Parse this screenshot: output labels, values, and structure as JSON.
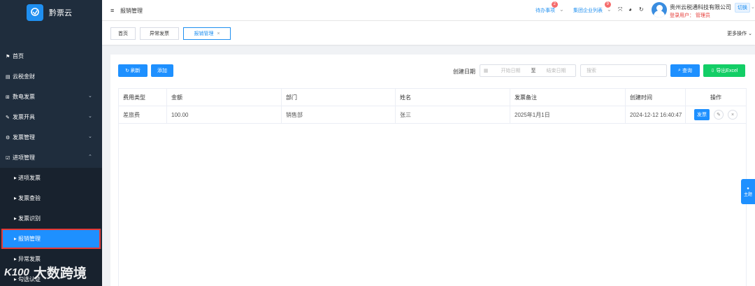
{
  "app": {
    "title": "黔票云",
    "logo_subtext": "黔票云"
  },
  "sidebar": {
    "items": [
      {
        "label": "首页",
        "icon": "home-icon",
        "glyph": "⚑"
      },
      {
        "label": "云税金财",
        "icon": "document-icon",
        "glyph": "▤"
      },
      {
        "label": "数电发票",
        "icon": "plus-square-icon",
        "glyph": "⊞"
      },
      {
        "label": "发票开具",
        "icon": "pen-icon",
        "glyph": "✎"
      },
      {
        "label": "发票管理",
        "icon": "gear-icon",
        "glyph": "⚙"
      },
      {
        "label": "进项管理",
        "icon": "edit-square-icon",
        "glyph": "☑"
      }
    ],
    "subitems": [
      {
        "label": "进项发票"
      },
      {
        "label": "发票查验"
      },
      {
        "label": "发票识别"
      },
      {
        "label": "报销管理"
      },
      {
        "label": "异常发票"
      },
      {
        "label": "勾选认证"
      }
    ]
  },
  "topbar": {
    "breadcrumb": "报销管理",
    "todo_label": "待办事项",
    "todo_count": "2",
    "group_list_label": "集团企业列表",
    "group_count": "9",
    "company_name": "贵州云税通科技有限公司",
    "switch_label": "切换",
    "login_user": "登录用户： 管理员"
  },
  "tabs": [
    {
      "label": "首页"
    },
    {
      "label": "异常发票"
    },
    {
      "label": "报销管理"
    }
  ],
  "more_ops": "更多操作",
  "toolbar": {
    "refresh": "刷新",
    "add": "添加",
    "date_label": "创建日期",
    "start_placeholder": "开始日期",
    "range_separator": "至",
    "end_placeholder": "结束日期",
    "search_placeholder": "搜索",
    "query": "查询",
    "export": "导出Excel"
  },
  "table": {
    "headers": [
      "费用类型",
      "金额",
      "部门",
      "姓名",
      "发票备注",
      "创建时间",
      "操作"
    ],
    "rows": [
      {
        "type": "差旅费",
        "amount": "100.00",
        "dept": "销售部",
        "name": "张三",
        "remark": "2025年1月1日",
        "created": "2024-12-12 16:40:47",
        "action_invoice": "发票"
      }
    ]
  },
  "theme_tab": "主题",
  "watermark": {
    "logo": "K100",
    "text": "大数跨境"
  },
  "colors": {
    "sidebar_bg": "#1f2d3d",
    "primary": "#1e90ff",
    "success": "#13ce66",
    "danger": "#e53935"
  }
}
